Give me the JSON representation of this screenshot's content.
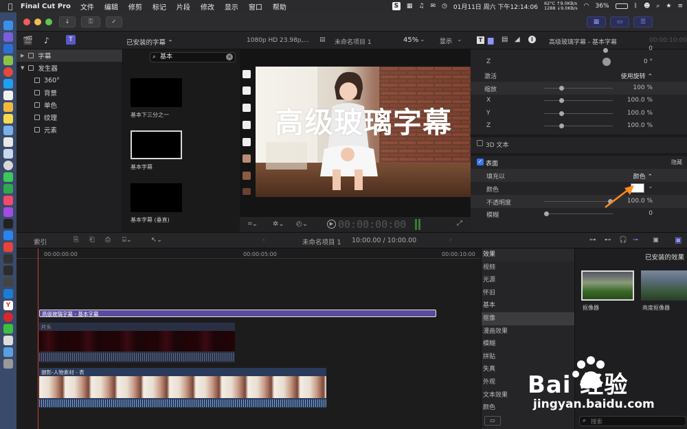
{
  "menubar": {
    "app_name": "Final Cut Pro",
    "items": [
      "文件",
      "编辑",
      "修剪",
      "标记",
      "片段",
      "修改",
      "显示",
      "窗口",
      "帮助"
    ],
    "datetime": "01月11日 周六 下午12:14:06",
    "network": {
      "line1": "62°C ↑9.0KB/s",
      "line2": "1288 ↓9.0KB/s"
    },
    "battery": "36%"
  },
  "browser": {
    "dropdown": "已安装的字幕 ⌃",
    "search_value": "基本",
    "sidebar": [
      {
        "label": "字幕",
        "level": 0,
        "selected": true,
        "arrow": "▶"
      },
      {
        "label": "发生器",
        "level": 0,
        "selected": false,
        "arrow": "▼"
      },
      {
        "label": "360°",
        "level": 1
      },
      {
        "label": "背景",
        "level": 1
      },
      {
        "label": "单色",
        "level": 1
      },
      {
        "label": "纹理",
        "level": 1
      },
      {
        "label": "元素",
        "level": 1
      }
    ],
    "thumbs": [
      {
        "label": "基本下三分之一",
        "selected": false
      },
      {
        "label": "基本字幕",
        "selected": true
      },
      {
        "label": "基本字幕 (垂直)",
        "selected": false
      }
    ]
  },
  "viewer": {
    "format": "1080p HD 23.98p,...",
    "project": "未命名项目 1",
    "zoom": "45%",
    "display": "显示",
    "overlay_title": "高级玻璃字幕",
    "timecode": "00:00:00:00"
  },
  "inspector": {
    "title": "高级玻璃字幕 - 基本字幕",
    "timecode": "00:00:10:00",
    "rows": [
      {
        "label": "Z",
        "value": "0 °",
        "type": "dial"
      },
      {
        "label": "激活",
        "value": "使用旋转 ⌃",
        "type": "popup"
      },
      {
        "label": "缩放",
        "value": "100 %",
        "type": "slider",
        "highlight": true
      },
      {
        "label": "X",
        "value": "100.0 %",
        "type": "slider"
      },
      {
        "label": "Y",
        "value": "100.0 %",
        "type": "slider"
      },
      {
        "label": "Z",
        "value": "100.0 %",
        "type": "slider"
      }
    ],
    "text3d_label": "3D 文本",
    "surface_label": "表面",
    "surface_hide": "隐藏",
    "fill_label": "填充以",
    "fill_value": "颜色 ⌃",
    "color_label": "颜色",
    "opacity_label": "不透明度",
    "opacity_value": "100.0 %",
    "blur_label": "模糊",
    "blur_value": "0",
    "highlight_color": "#ff8a1f"
  },
  "timeline": {
    "index_label": "索引",
    "project_label": "未命名项目 1",
    "duration": "10:00.00 / 10:00.00",
    "ruler": [
      "00:00:00:00",
      "00:00:05:00",
      "00:00:10:00"
    ],
    "title_clip": "高级玻璃字幕 - 基本字幕",
    "clip1_label": "片头",
    "clip2_label": "摄影-人物素材 - 表"
  },
  "effects": {
    "header": "效果",
    "browser_title": "已安装的效果",
    "categories": [
      "视频",
      "光源",
      "怀旧",
      "基本",
      "抠像",
      "漫画效果",
      "模糊",
      "拼贴",
      "失真",
      "外观",
      "文本效果",
      "颜色"
    ],
    "selected": "抠像",
    "items": [
      "抠像器",
      "亮度抠像器"
    ],
    "search_placeholder": "搜索"
  },
  "watermark": {
    "brand": "Bai 经验",
    "url": "jingyan.baidu.com"
  }
}
